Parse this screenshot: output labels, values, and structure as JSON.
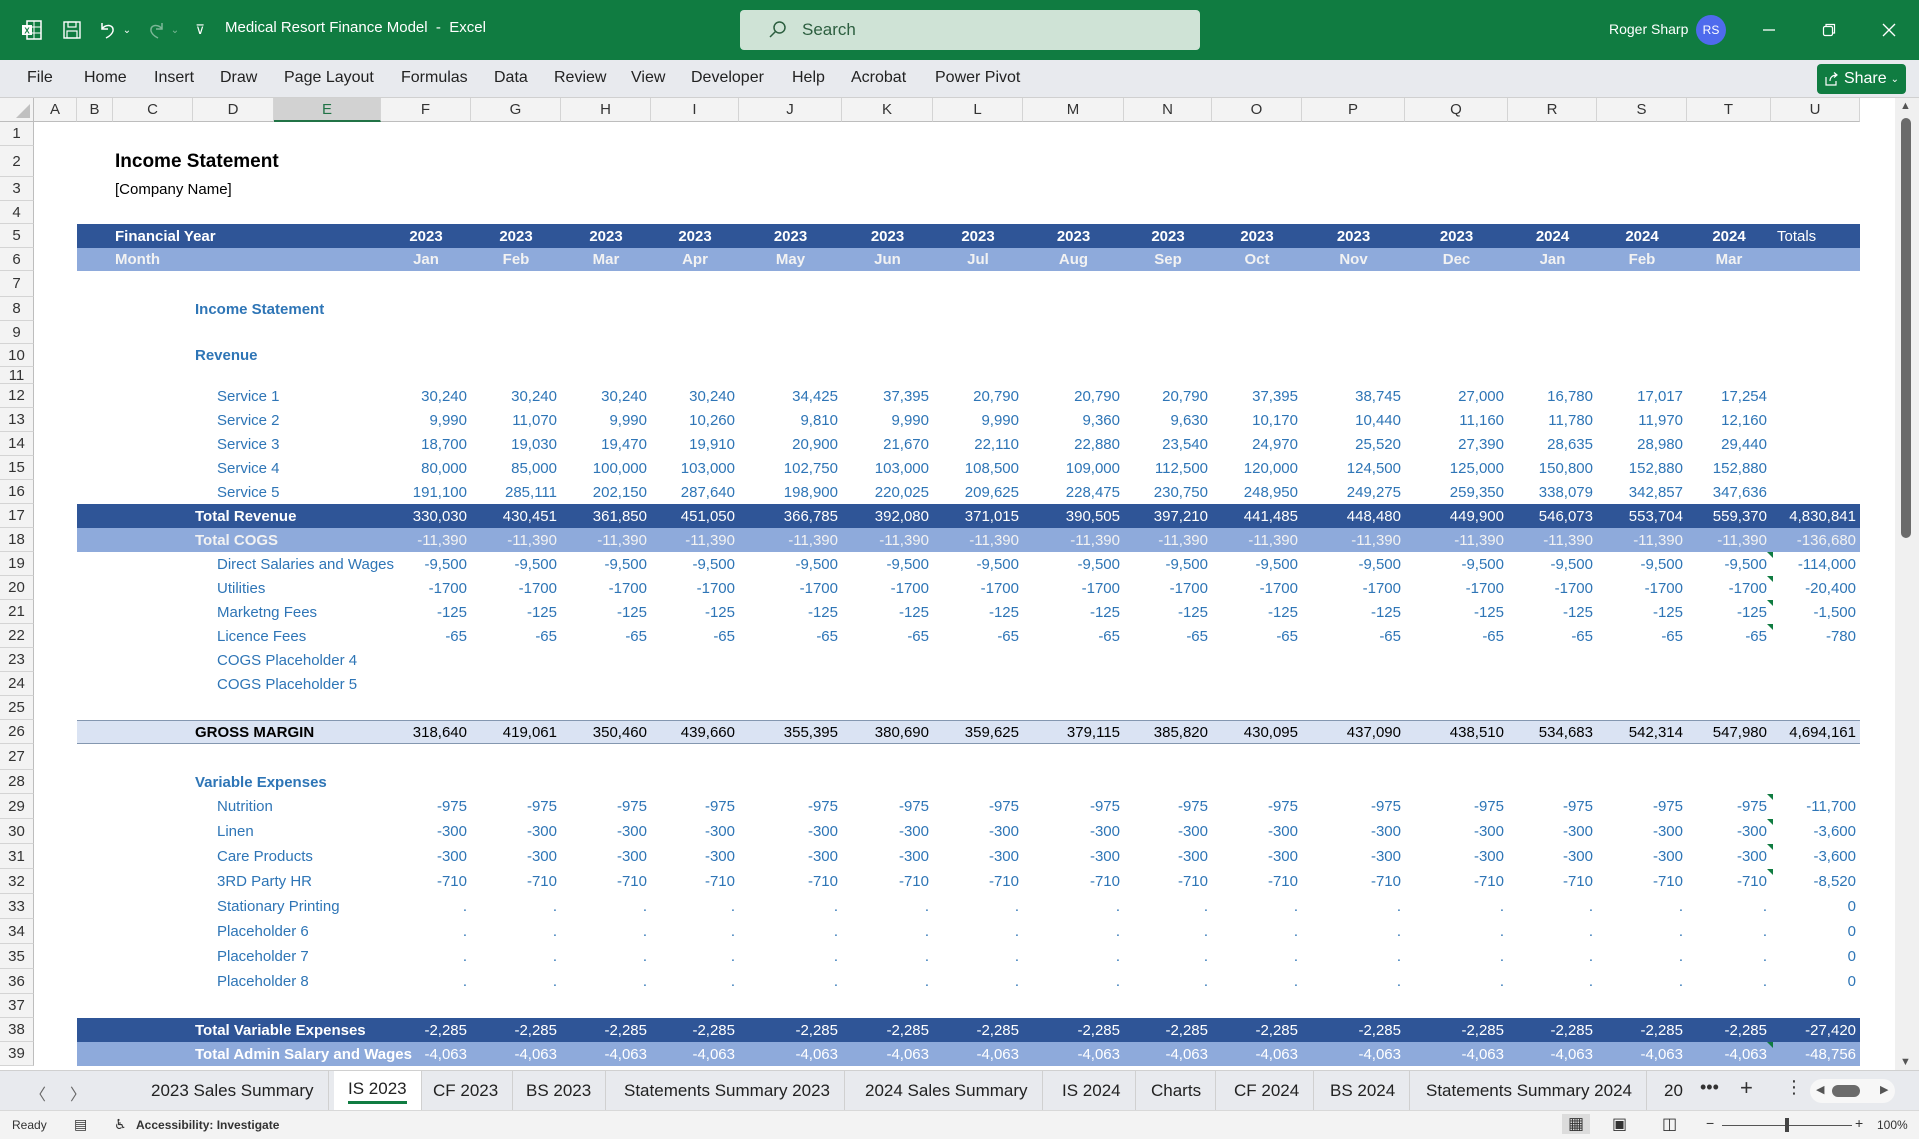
{
  "titlebar": {
    "doc_title": "Medical Resort Finance Model  -  Excel",
    "search_placeholder": "Search",
    "user_name": "Roger Sharp",
    "user_initials": "RS",
    "icons": [
      "excel-logo-icon",
      "save-icon",
      "undo-icon",
      "redo-icon",
      "customize-qat-icon",
      "minimize-icon",
      "restore-icon",
      "close-icon"
    ]
  },
  "ribbon": {
    "tabs": [
      "File",
      "Home",
      "Insert",
      "Draw",
      "Page Layout",
      "Formulas",
      "Data",
      "Review",
      "View",
      "Developer",
      "Help",
      "Acrobat",
      "Power Pivot"
    ],
    "share_label": "Share"
  },
  "grid": {
    "columns": [
      "A",
      "B",
      "C",
      "D",
      "E",
      "F",
      "G",
      "H",
      "I",
      "J",
      "K",
      "L",
      "M",
      "N",
      "O",
      "P",
      "Q",
      "R",
      "S",
      "T",
      "U"
    ],
    "selected_column": "E",
    "rows": [
      "1",
      "2",
      "3",
      "4",
      "5",
      "6",
      "7",
      "8",
      "9",
      "10",
      "11",
      "12",
      "13",
      "14",
      "15",
      "16",
      "17",
      "18",
      "19",
      "20",
      "21",
      "22",
      "23",
      "24",
      "25",
      "26",
      "27",
      "28",
      "29",
      "30",
      "31",
      "32",
      "33",
      "34",
      "35",
      "36",
      "37",
      "38",
      "39"
    ]
  },
  "sheet": {
    "title": "Income Statement",
    "company": "[Company Name]",
    "header_fy_label": "Financial Year",
    "header_month_label": "Month",
    "years": [
      "2023",
      "2023",
      "2023",
      "2023",
      "2023",
      "2023",
      "2023",
      "2023",
      "2023",
      "2023",
      "2023",
      "2023",
      "2024",
      "2024",
      "2024"
    ],
    "months": [
      "Jan",
      "Feb",
      "Mar",
      "Apr",
      "May",
      "Jun",
      "Jul",
      "Aug",
      "Sep",
      "Oct",
      "Nov",
      "Dec",
      "Jan",
      "Feb",
      "Mar"
    ],
    "totals_label": "Totals",
    "section_income": "Income Statement",
    "section_revenue": "Revenue",
    "section_variable": "Variable Expenses",
    "revenue_lines": [
      {
        "label": "Service 1",
        "values": [
          "30,240",
          "30,240",
          "30,240",
          "30,240",
          "34,425",
          "37,395",
          "20,790",
          "20,790",
          "20,790",
          "37,395",
          "38,745",
          "27,000",
          "16,780",
          "17,017",
          "17,254"
        ],
        "total": ""
      },
      {
        "label": "Service 2",
        "values": [
          "9,990",
          "11,070",
          "9,990",
          "10,260",
          "9,810",
          "9,990",
          "9,990",
          "9,360",
          "9,630",
          "10,170",
          "10,440",
          "11,160",
          "11,780",
          "11,970",
          "12,160"
        ],
        "total": ""
      },
      {
        "label": "Service 3",
        "values": [
          "18,700",
          "19,030",
          "19,470",
          "19,910",
          "20,900",
          "21,670",
          "22,110",
          "22,880",
          "23,540",
          "24,970",
          "25,520",
          "27,390",
          "28,635",
          "28,980",
          "29,440"
        ],
        "total": ""
      },
      {
        "label": "Service 4",
        "values": [
          "80,000",
          "85,000",
          "100,000",
          "103,000",
          "102,750",
          "103,000",
          "108,500",
          "109,000",
          "112,500",
          "120,000",
          "124,500",
          "125,000",
          "150,800",
          "152,880",
          "152,880"
        ],
        "total": ""
      },
      {
        "label": "Service 5",
        "values": [
          "191,100",
          "285,111",
          "202,150",
          "287,640",
          "198,900",
          "220,025",
          "209,625",
          "228,475",
          "230,750",
          "248,950",
          "249,275",
          "259,350",
          "338,079",
          "342,857",
          "347,636"
        ],
        "total": ""
      }
    ],
    "total_revenue": {
      "label": "Total Revenue",
      "values": [
        "330,030",
        "430,451",
        "361,850",
        "451,050",
        "366,785",
        "392,080",
        "371,015",
        "390,505",
        "397,210",
        "441,485",
        "448,480",
        "449,900",
        "546,073",
        "553,704",
        "559,370"
      ],
      "total": "4,830,841"
    },
    "total_cogs": {
      "label": "Total COGS",
      "values": [
        "-11,390",
        "-11,390",
        "-11,390",
        "-11,390",
        "-11,390",
        "-11,390",
        "-11,390",
        "-11,390",
        "-11,390",
        "-11,390",
        "-11,390",
        "-11,390",
        "-11,390",
        "-11,390",
        "-11,390"
      ],
      "total": "-136,680"
    },
    "cogs_lines": [
      {
        "label": "Direct Salaries and Wages",
        "values": [
          "-9,500",
          "-9,500",
          "-9,500",
          "-9,500",
          "-9,500",
          "-9,500",
          "-9,500",
          "-9,500",
          "-9,500",
          "-9,500",
          "-9,500",
          "-9,500",
          "-9,500",
          "-9,500",
          "-9,500"
        ],
        "total": "-114,000"
      },
      {
        "label": "Utilities",
        "values": [
          "-1700",
          "-1700",
          "-1700",
          "-1700",
          "-1700",
          "-1700",
          "-1700",
          "-1700",
          "-1700",
          "-1700",
          "-1700",
          "-1700",
          "-1700",
          "-1700",
          "-1700"
        ],
        "total": "-20,400"
      },
      {
        "label": "Marketng Fees",
        "values": [
          "-125",
          "-125",
          "-125",
          "-125",
          "-125",
          "-125",
          "-125",
          "-125",
          "-125",
          "-125",
          "-125",
          "-125",
          "-125",
          "-125",
          "-125"
        ],
        "total": "-1,500"
      },
      {
        "label": "Licence Fees",
        "values": [
          "-65",
          "-65",
          "-65",
          "-65",
          "-65",
          "-65",
          "-65",
          "-65",
          "-65",
          "-65",
          "-65",
          "-65",
          "-65",
          "-65",
          "-65"
        ],
        "total": "-780"
      },
      {
        "label": "COGS Placeholder 4",
        "values": [
          "",
          "",
          "",
          "",
          "",
          "",
          "",
          "",
          "",
          "",
          "",
          "",
          "",
          "",
          ""
        ],
        "total": ""
      },
      {
        "label": "COGS Placeholder 5",
        "values": [
          "",
          "",
          "",
          "",
          "",
          "",
          "",
          "",
          "",
          "",
          "",
          "",
          "",
          "",
          ""
        ],
        "total": ""
      }
    ],
    "gross_margin": {
      "label": "GROSS MARGIN",
      "values": [
        "318,640",
        "419,061",
        "350,460",
        "439,660",
        "355,395",
        "380,690",
        "359,625",
        "379,115",
        "385,820",
        "430,095",
        "437,090",
        "438,510",
        "534,683",
        "542,314",
        "547,980"
      ],
      "total": "4,694,161"
    },
    "variable_lines": [
      {
        "label": "Nutrition",
        "values": [
          "-975",
          "-975",
          "-975",
          "-975",
          "-975",
          "-975",
          "-975",
          "-975",
          "-975",
          "-975",
          "-975",
          "-975",
          "-975",
          "-975",
          "-975"
        ],
        "total": "-11,700"
      },
      {
        "label": "Linen",
        "values": [
          "-300",
          "-300",
          "-300",
          "-300",
          "-300",
          "-300",
          "-300",
          "-300",
          "-300",
          "-300",
          "-300",
          "-300",
          "-300",
          "-300",
          "-300"
        ],
        "total": "-3,600"
      },
      {
        "label": "Care Products",
        "values": [
          "-300",
          "-300",
          "-300",
          "-300",
          "-300",
          "-300",
          "-300",
          "-300",
          "-300",
          "-300",
          "-300",
          "-300",
          "-300",
          "-300",
          "-300"
        ],
        "total": "-3,600"
      },
      {
        "label": "3RD Party HR",
        "values": [
          "-710",
          "-710",
          "-710",
          "-710",
          "-710",
          "-710",
          "-710",
          "-710",
          "-710",
          "-710",
          "-710",
          "-710",
          "-710",
          "-710",
          "-710"
        ],
        "total": "-8,520"
      },
      {
        "label": "Stationary Printing",
        "values": [
          ".",
          ".",
          ".",
          ".",
          ".",
          ".",
          ".",
          ".",
          ".",
          ".",
          ".",
          ".",
          ".",
          ".",
          "."
        ],
        "total": "0"
      },
      {
        "label": "Placeholder 6",
        "values": [
          ".",
          ".",
          ".",
          ".",
          ".",
          ".",
          ".",
          ".",
          ".",
          ".",
          ".",
          ".",
          ".",
          ".",
          "."
        ],
        "total": "0"
      },
      {
        "label": "Placeholder 7",
        "values": [
          ".",
          ".",
          ".",
          ".",
          ".",
          ".",
          ".",
          ".",
          ".",
          ".",
          ".",
          ".",
          ".",
          ".",
          "."
        ],
        "total": "0"
      },
      {
        "label": "Placeholder 8",
        "values": [
          ".",
          ".",
          ".",
          ".",
          ".",
          ".",
          ".",
          ".",
          ".",
          ".",
          ".",
          ".",
          ".",
          ".",
          "."
        ],
        "total": "0"
      }
    ],
    "total_variable": {
      "label": "Total Variable Expenses",
      "values": [
        "-2,285",
        "-2,285",
        "-2,285",
        "-2,285",
        "-2,285",
        "-2,285",
        "-2,285",
        "-2,285",
        "-2,285",
        "-2,285",
        "-2,285",
        "-2,285",
        "-2,285",
        "-2,285",
        "-2,285"
      ],
      "total": "-27,420"
    },
    "total_admin": {
      "label": "Total Admin Salary and Wages",
      "values": [
        "-4,063",
        "-4,063",
        "-4,063",
        "-4,063",
        "-4,063",
        "-4,063",
        "-4,063",
        "-4,063",
        "-4,063",
        "-4,063",
        "-4,063",
        "-4,063",
        "-4,063",
        "-4,063",
        "-4,063"
      ],
      "total": "-48,756"
    }
  },
  "sheet_tabs": {
    "tabs": [
      "2023 Sales Summary",
      "IS 2023",
      "CF 2023",
      "BS 2023",
      "Statements Summary 2023",
      "2024 Sales Summary",
      "IS 2024",
      "Charts",
      "CF 2024",
      "BS 2024",
      "Statements Summary 2024",
      "20"
    ],
    "active": "IS 2023"
  },
  "statusbar": {
    "ready": "Ready",
    "accessibility": "Accessibility: Investigate",
    "zoom": "100%",
    "zoom_level_percent": 100
  },
  "colors": {
    "titlebar": "#107c41",
    "band_dark": "#2f5597",
    "band_light": "#8eaadb",
    "gross_margin_fill": "#dae3f3",
    "label_blue": "#2e75b6"
  }
}
